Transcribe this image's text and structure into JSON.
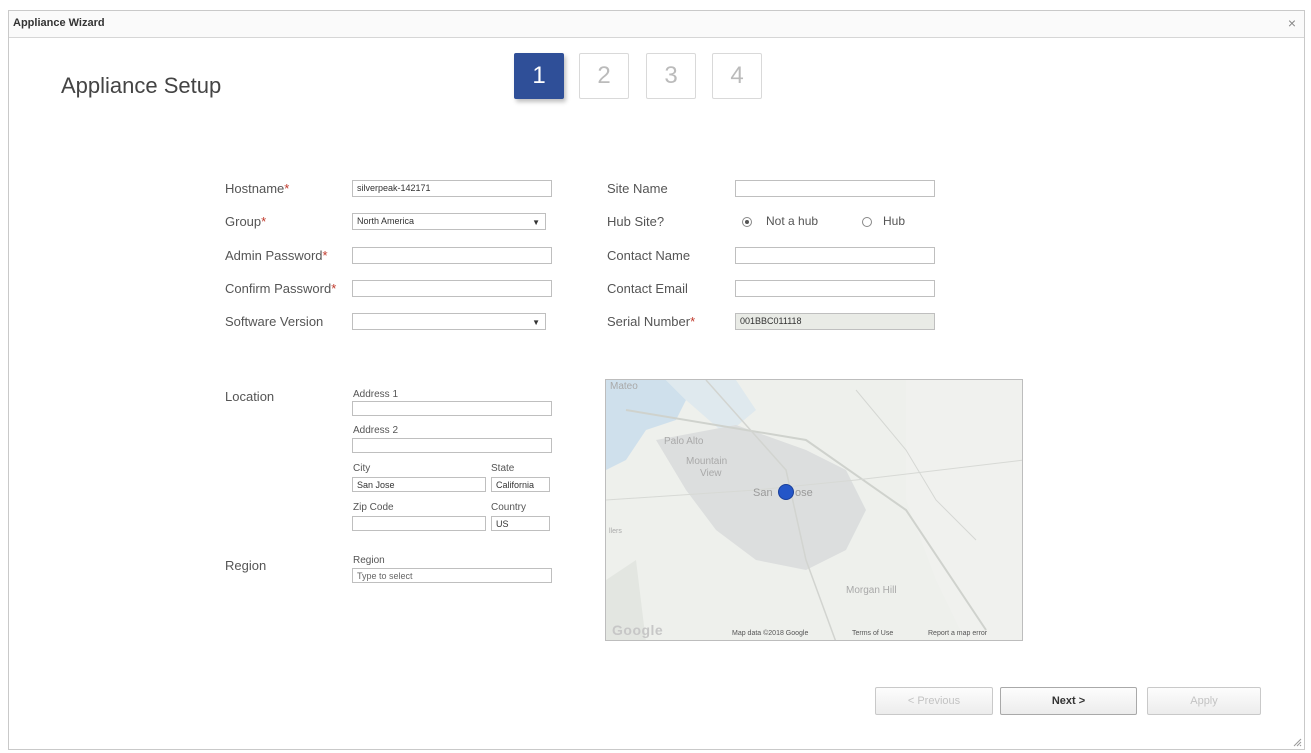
{
  "window": {
    "title": "Appliance Wizard",
    "close_glyph": "×"
  },
  "page": {
    "heading": "Appliance Setup"
  },
  "steps": [
    {
      "label": "1",
      "active": true
    },
    {
      "label": "2",
      "active": false
    },
    {
      "label": "3",
      "active": false
    },
    {
      "label": "4",
      "active": false
    }
  ],
  "form": {
    "hostname": {
      "label": "Hostname",
      "required": "*",
      "value": "silverpeak-142171"
    },
    "group": {
      "label": "Group",
      "required": "*",
      "value": "North America",
      "caret": "▼"
    },
    "admin_password": {
      "label": "Admin Password",
      "required": "*",
      "value": ""
    },
    "confirm_password": {
      "label": "Confirm Password",
      "required": "*",
      "value": ""
    },
    "software_version": {
      "label": "Software Version",
      "value": "",
      "caret": "▼"
    },
    "site_name": {
      "label": "Site Name",
      "value": ""
    },
    "hub_site": {
      "label": "Hub Site?",
      "options": [
        {
          "label": "Not a hub",
          "checked": true
        },
        {
          "label": "Hub",
          "checked": false
        }
      ]
    },
    "contact_name": {
      "label": "Contact Name",
      "value": ""
    },
    "contact_email": {
      "label": "Contact Email",
      "value": ""
    },
    "serial_number": {
      "label": "Serial Number",
      "required": "*",
      "value": "001BBC011118"
    }
  },
  "location": {
    "section_label": "Location",
    "address1": {
      "label": "Address 1",
      "value": ""
    },
    "address2": {
      "label": "Address 2",
      "value": ""
    },
    "city": {
      "label": "City",
      "value": "San Jose"
    },
    "state": {
      "label": "State",
      "value": "California"
    },
    "zip": {
      "label": "Zip Code",
      "value": ""
    },
    "country": {
      "label": "Country",
      "value": "US"
    }
  },
  "region": {
    "section_label": "Region",
    "field_label": "Region",
    "placeholder": "Type to select"
  },
  "map": {
    "places": {
      "top": "Mateo",
      "palo_alto": "Palo Alto",
      "mountain": "Mountain",
      "view": "View",
      "san": "San",
      "jose": "ose",
      "morgan_hill": "Morgan Hill",
      "left": "llers"
    },
    "google": "Google",
    "footer": {
      "map_data": "Map data ©2018 Google",
      "terms": "Terms of Use",
      "report": "Report a map error"
    }
  },
  "buttons": {
    "previous": "< Previous",
    "next": "Next >",
    "apply": "Apply"
  },
  "colors": {
    "accent": "#2f4f98",
    "required": "#c0392b",
    "map_pin": "#2456c8"
  }
}
